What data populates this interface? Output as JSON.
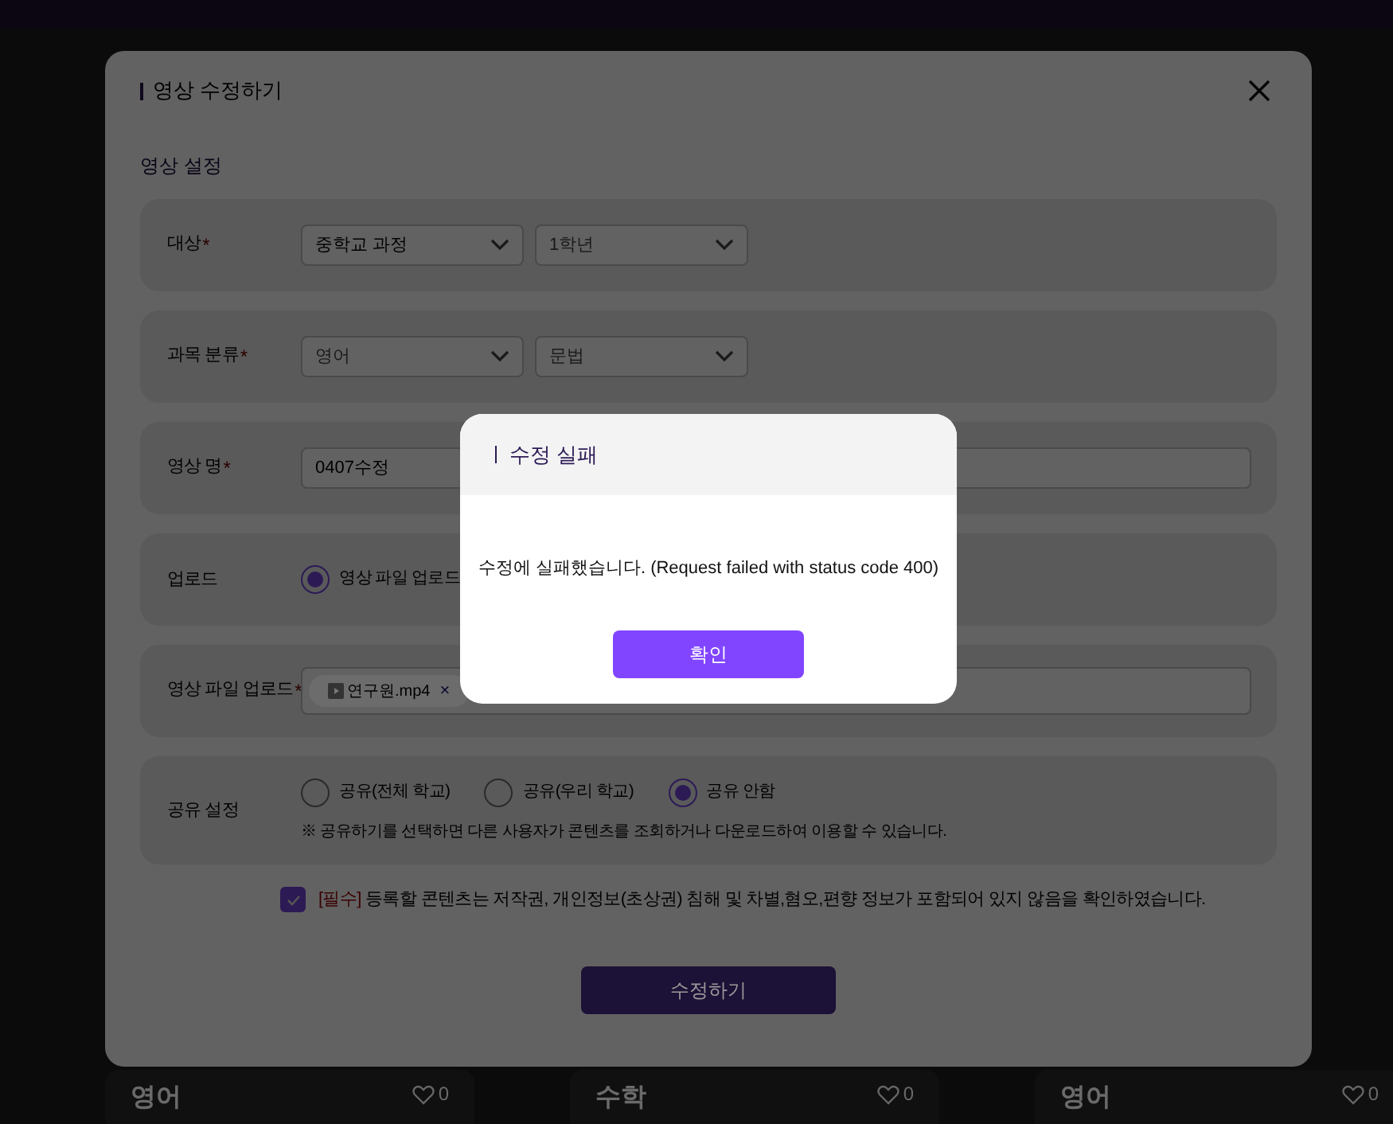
{
  "modal": {
    "title": "영상 수정하기",
    "section_title": "영상 설정",
    "rows": [
      {
        "kind": "select",
        "label": "대상",
        "required": "*",
        "selects": [
          {
            "value": "중학교 과정",
            "placeholder_style": false
          },
          {
            "value": "1학년",
            "placeholder_style": true
          }
        ]
      },
      {
        "kind": "select",
        "label": "과목 분류",
        "required": "*",
        "selects": [
          {
            "value": "영어",
            "placeholder_style": true
          },
          {
            "value": "문법",
            "placeholder_style": true
          }
        ]
      },
      {
        "kind": "text",
        "label": "영상 명",
        "required": "*",
        "value": "0407수정"
      },
      {
        "kind": "radio",
        "label": "업로드",
        "options": [
          {
            "label": "영상 파일 업로드",
            "selected": true
          }
        ]
      },
      {
        "kind": "file",
        "label": "영상 파일 업로드",
        "required": "*",
        "file": "연구원.mp4",
        "remove": "×"
      },
      {
        "kind": "radio",
        "label": "공유 설정",
        "options": [
          {
            "label": "공유(전체 학교)",
            "selected": false
          },
          {
            "label": "공유(우리 학교)",
            "selected": false
          },
          {
            "label": "공유 안함",
            "selected": true
          }
        ],
        "note": "※ 공유하기를 선택하면 다른 사용자가 콘텐츠를 조회하거나 다운로드하여 이용할 수 있습니다."
      }
    ],
    "consent": {
      "checked": true,
      "tag": "[필수]",
      "text": "등록할 콘텐츠는 저작권, 개인정보(초상권) 침해 및 차별,혐오,편향 정보가 포함되어 있지 않음을 확인하였습니다."
    },
    "submit": "수정하기"
  },
  "background_cards": [
    {
      "subject": "영어",
      "likes": "0"
    },
    {
      "subject": "수학",
      "likes": "0"
    },
    {
      "subject": "영어",
      "likes": "0"
    }
  ],
  "alert": {
    "title": "수정 실패",
    "message": "수정에 실패했습니다. (Request failed with status code 400)",
    "button": "확인"
  }
}
